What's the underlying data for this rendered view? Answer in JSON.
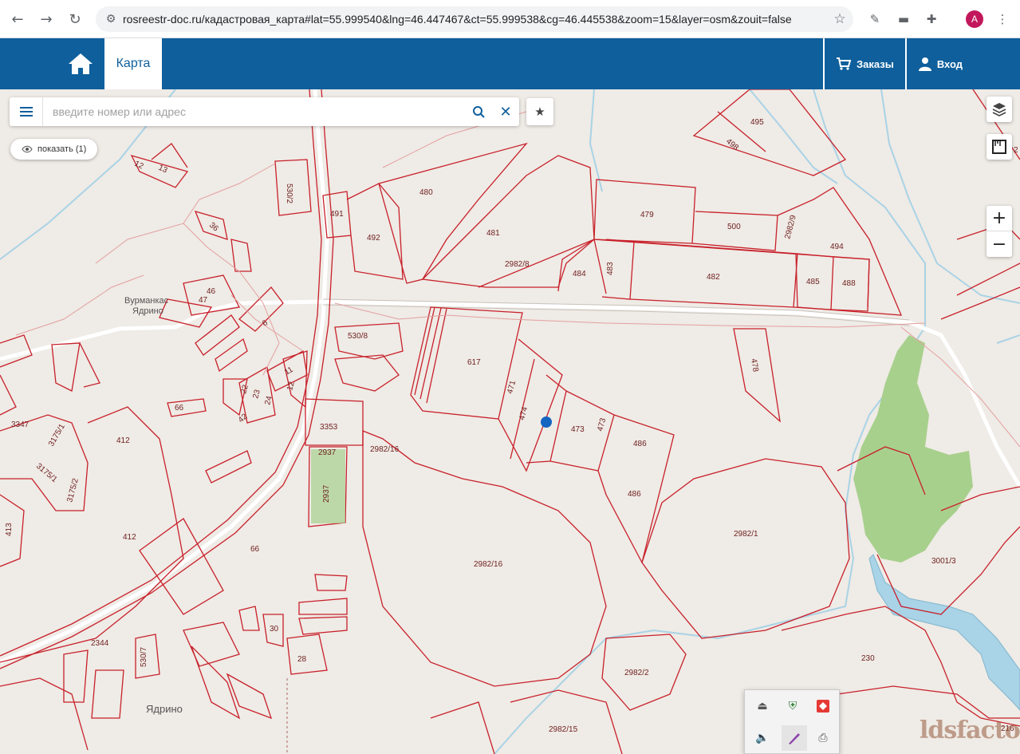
{
  "browser": {
    "url": "rosreestr-doc.ru/кадастровая_карта#lat=55.999540&lng=46.447467&ct=55.999538&cg=46.445538&zoom=15&layer=osm&zouit=false",
    "profile_initial": "A"
  },
  "header": {
    "tab_map": "Карта",
    "orders": "Заказы",
    "login": "Вход"
  },
  "search": {
    "placeholder": "введите номер или адрес",
    "show_button": "показать (1)"
  },
  "map": {
    "colors": {
      "parcel": "#c8202a",
      "road": "#ffffff",
      "water": "#a9d3e6",
      "forest": "#a8d08d",
      "background": "#efebe6",
      "marker": "#1565c0"
    },
    "places": [
      "Вурманкас Ядрино",
      "Ядрино"
    ],
    "parcels": [
      "495",
      "498",
      "480",
      "530/2",
      "491",
      "492",
      "481",
      "479",
      "500",
      "2982/9",
      "494",
      "2982/8",
      "484",
      "483",
      "482",
      "485",
      "488",
      "12",
      "13",
      "36",
      "46",
      "47",
      "6",
      "530/8",
      "617",
      "478",
      "471",
      "474",
      "473",
      "473",
      "486",
      "486",
      "11",
      "12",
      "22",
      "23",
      "24",
      "42",
      "66",
      "3353",
      "2937",
      "2937",
      "2982/16",
      "2982/1",
      "3347",
      "3175/1",
      "3175/1",
      "3175/2",
      "412",
      "412",
      "413",
      "66",
      "2982/16",
      "3001/3",
      "2344",
      "530/7",
      "30",
      "28",
      "230",
      "2982/2",
      "2982/15",
      "216"
    ]
  },
  "tray": {
    "icons": [
      "usb-icon",
      "shield-check-icon",
      "anydesk-icon",
      "speaker-icon",
      "pen-icon",
      "printer-warning-icon"
    ]
  },
  "watermark": "ldsfactory"
}
